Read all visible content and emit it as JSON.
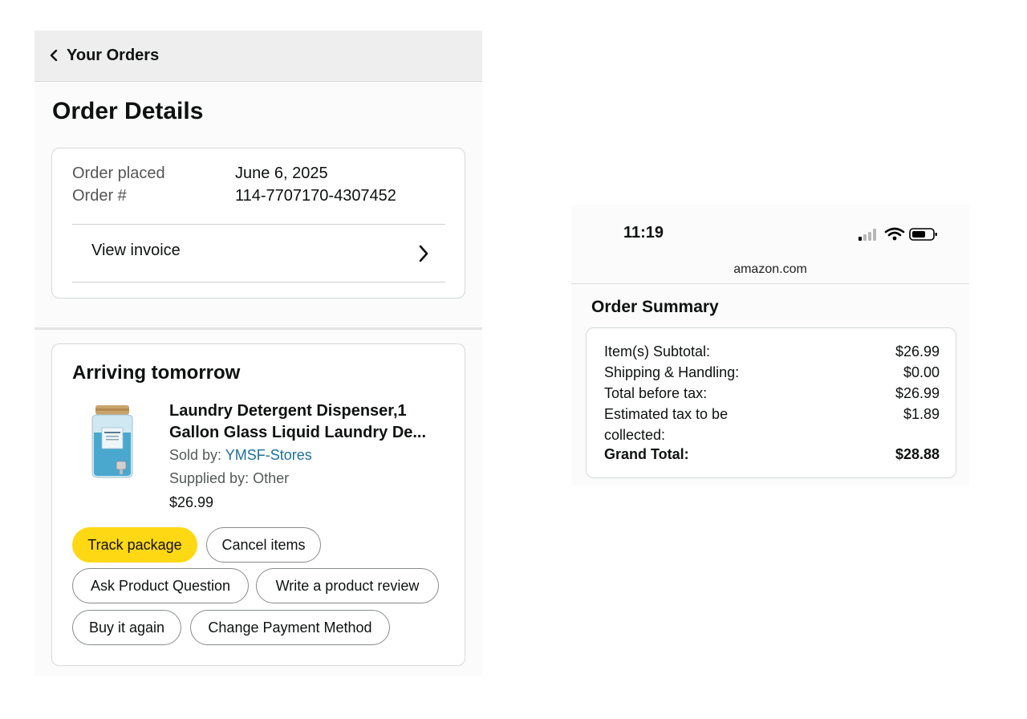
{
  "header": {
    "back_label": "Your Orders"
  },
  "page_title": "Order Details",
  "order_info": {
    "placed_label": "Order placed",
    "placed_value": "June 6, 2025",
    "number_label": "Order #",
    "number_value": "114-7707170-4307452",
    "invoice_label": "View invoice"
  },
  "shipment": {
    "status": "Arriving tomorrow",
    "product": {
      "title_line1": "Laundry Detergent Dispenser,1",
      "title_line2": "Gallon Glass Liquid Laundry De...",
      "sold_by_label": "Sold by:",
      "seller": "YMSF-Stores",
      "supplied_by": "Supplied by: Other",
      "price": "$26.99"
    },
    "buttons": {
      "track": "Track package",
      "cancel": "Cancel items",
      "ask": "Ask Product Question",
      "review": "Write a product review",
      "buy_again": "Buy it again",
      "change_payment": "Change Payment Method"
    }
  },
  "phone": {
    "time": "11:19",
    "domain": "amazon.com"
  },
  "order_summary": {
    "title": "Order Summary",
    "rows": [
      {
        "label": "Item(s) Subtotal:",
        "value": "$26.99"
      },
      {
        "label": "Shipping & Handling:",
        "value": "$0.00"
      },
      {
        "label": "Total before tax:",
        "value": "$26.99"
      },
      {
        "label": "Estimated tax to be collected:",
        "value": "$1.89"
      },
      {
        "label": "Grand Total:",
        "value": "$28.88"
      }
    ]
  },
  "colors": {
    "primary_button": "#ffd814",
    "link": "#1a6fa0",
    "header_bg": "#eeeeee"
  },
  "icons": [
    "chevron-left-icon",
    "chevron-right-icon",
    "signal-icon",
    "wifi-icon",
    "battery-icon"
  ]
}
